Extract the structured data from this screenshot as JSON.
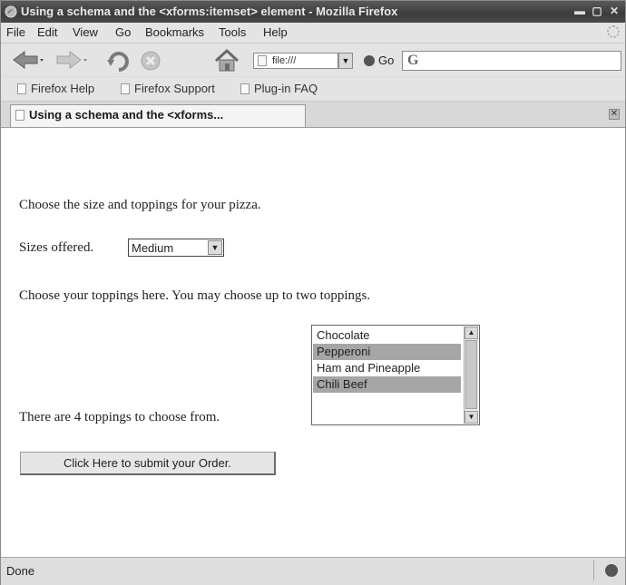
{
  "window": {
    "title": "Using a schema and the <xforms:itemset> element - Mozilla Firefox"
  },
  "menu": {
    "items": [
      "File",
      "Edit",
      "View",
      "Go",
      "Bookmarks",
      "Tools",
      "Help"
    ]
  },
  "toolbar": {
    "url": "file:///",
    "go_label": "Go",
    "search_value": ""
  },
  "bookmarks": {
    "items": [
      "Firefox Help",
      "Firefox Support",
      "Plug-in FAQ"
    ]
  },
  "tab": {
    "label": "Using a schema and the <xforms..."
  },
  "page": {
    "intro": "Choose the size and toppings for your pizza.",
    "sizes_label": "Sizes offered.",
    "size_selected": "Medium",
    "toppings_prompt": "Choose your toppings here. You may choose up to two toppings.",
    "toppings_count": "There are 4 toppings to choose from.",
    "toppings": [
      {
        "label": "Chocolate",
        "selected": false
      },
      {
        "label": "Pepperoni",
        "selected": true
      },
      {
        "label": "Ham and Pineapple",
        "selected": false
      },
      {
        "label": "Chili Beef",
        "selected": true
      }
    ],
    "submit_label": "Click Here to submit your Order."
  },
  "status": {
    "text": "Done"
  }
}
